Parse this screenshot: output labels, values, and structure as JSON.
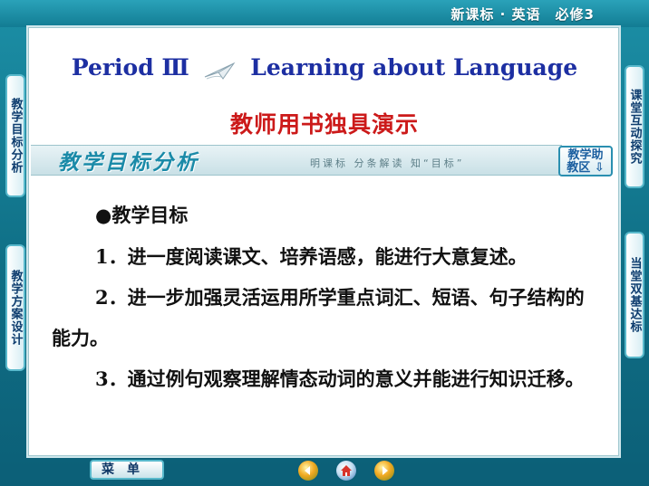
{
  "header": {
    "course_tag": "新课标 · 英语　必修3"
  },
  "slide": {
    "title_left": "Period Ⅲ",
    "title_right": "Learning about Language",
    "subtitle": "教师用书独具演示",
    "section_title": "教学目标分析",
    "section_hint": "明课标 分条解读 知“目标”",
    "helper_label_1": "教学助",
    "helper_label_2": "教区 ⇩",
    "objectives_heading": "●教学目标",
    "objectives": [
      "1．进一度阅读课文、培养语感，能进行大意复述。",
      "2．进一步加强灵活运用所学重点词汇、短语、句子结构的能力。",
      "3．通过例句观察理解情态动词的意义并能进行知识迁移。"
    ]
  },
  "left_tabs": [
    "教学目标分析",
    "教学方案设计"
  ],
  "right_tabs": [
    "课堂互动探究",
    "当堂双基达标"
  ],
  "footer": {
    "menu_label": "菜单"
  },
  "icons": {
    "prev": "arrow-left-icon",
    "home": "home-icon",
    "next": "arrow-right-icon",
    "title_deco": "paper-plane-icon"
  },
  "colors": {
    "frame": "#127c93",
    "title_blue": "#1d2fa2",
    "subtitle_red": "#cc1a1a",
    "section_teal": "#1a8aa8"
  }
}
